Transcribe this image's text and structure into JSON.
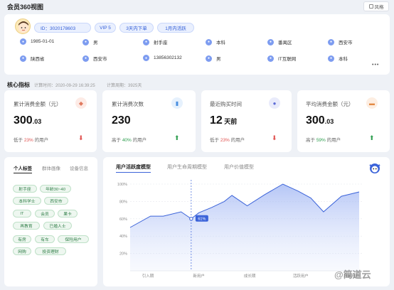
{
  "header": {
    "title": "会员360视图",
    "style_button": "风格"
  },
  "profile": {
    "id_label": "ID：3020178603",
    "vip": "VIP 5",
    "tag_order": "3天内下单",
    "tag_active": "1月内活跃",
    "row1": [
      "1985-01-01",
      "男",
      "射手座",
      "本科",
      "番禺区",
      "西安市"
    ],
    "row2": [
      "陕西省",
      "西安市",
      "13856302132",
      "男",
      "IT互联网",
      "本科"
    ],
    "more": "•••"
  },
  "section": {
    "title": "核心指标",
    "calc_time": "计算时间：2020-09-29 16:39:25",
    "calc_period": "计算周期：3925天"
  },
  "metrics": [
    {
      "label": "累计消费金额（元）",
      "value_int": "300",
      "value_dec": ".03",
      "foot_pre": "低于",
      "pct": "23%",
      "foot_post": "的用户",
      "trend": "down"
    },
    {
      "label": "累计消费次数",
      "value_int": "230",
      "value_dec": "",
      "foot_pre": "高于",
      "pct": "40%",
      "foot_post": "的用户",
      "trend": "up"
    },
    {
      "label": "最近购买时间",
      "value_int": "12",
      "value_dec": " 天前",
      "foot_pre": "低于",
      "pct": "23%",
      "foot_post": "的用户",
      "trend": "down"
    },
    {
      "label": "平均消费金额（元）",
      "value_int": "300",
      "value_dec": ".03",
      "foot_pre": "高于",
      "pct": "59%",
      "foot_post": "的用户",
      "trend": "up"
    }
  ],
  "colors": {
    "up": "#2e9e4f",
    "down": "#e0514f",
    "accent": "#3b63d9",
    "green_pct": "#2e9e4f",
    "red_pct": "#e0514f"
  },
  "left_tabs": [
    "个人标签",
    "群体画像",
    "设备信息"
  ],
  "labels": [
    "射手座",
    "年龄30~40",
    "本科学士",
    "西安市",
    "IT",
    "会员",
    "果卡",
    "再教育",
    "已婚人士",
    "有房",
    "有车",
    "保险用户",
    "网购",
    "投资理财"
  ],
  "chart_tabs": [
    "用户活跃度模型",
    "用户生命周期模型",
    "用户价值模型"
  ],
  "chart_data": {
    "type": "area",
    "yticks": [
      "100%",
      "80%",
      "60%",
      "40%",
      "20%"
    ],
    "ylim": [
      0,
      100
    ],
    "categories": [
      "引入期",
      "新用户",
      "成长期",
      "活跃用户",
      "忠诚用户"
    ],
    "x": [
      0,
      0.4,
      0.65,
      1.0,
      1.2,
      1.35,
      1.6,
      1.85,
      2.0,
      2.3,
      2.65,
      3.0,
      3.3,
      3.55,
      3.8,
      4.15,
      4.5
    ],
    "values": [
      50,
      63,
      63,
      68,
      60,
      67,
      73,
      80,
      87,
      75,
      88,
      100,
      92,
      84,
      68,
      86,
      91
    ],
    "marker": {
      "x": 1.2,
      "label": "61%"
    },
    "grid": true
  },
  "watermark": "@简道云"
}
